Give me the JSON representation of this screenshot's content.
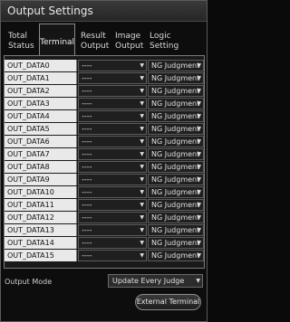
{
  "window": {
    "title": "Output Settings"
  },
  "tabs": [
    {
      "label_line1": "Total",
      "label_line2": "Status",
      "active": false
    },
    {
      "label_line1": "Terminal",
      "label_line2": "",
      "active": true
    },
    {
      "label_line1": "Result",
      "label_line2": "Output",
      "active": false
    },
    {
      "label_line1": "Image",
      "label_line2": "Output",
      "active": false
    },
    {
      "label_line1": "Logic",
      "label_line2": "Setting",
      "active": false
    }
  ],
  "rows": [
    {
      "name": "OUT_DATA0",
      "item": "----",
      "mode": "NG Judgment"
    },
    {
      "name": "OUT_DATA1",
      "item": "----",
      "mode": "NG Judgment"
    },
    {
      "name": "OUT_DATA2",
      "item": "----",
      "mode": "NG Judgment"
    },
    {
      "name": "OUT_DATA3",
      "item": "----",
      "mode": "NG Judgment"
    },
    {
      "name": "OUT_DATA4",
      "item": "----",
      "mode": "NG Judgment"
    },
    {
      "name": "OUT_DATA5",
      "item": "----",
      "mode": "NG Judgment"
    },
    {
      "name": "OUT_DATA6",
      "item": "----",
      "mode": "NG Judgment"
    },
    {
      "name": "OUT_DATA7",
      "item": "----",
      "mode": "NG Judgment"
    },
    {
      "name": "OUT_DATA8",
      "item": "----",
      "mode": "NG Judgment"
    },
    {
      "name": "OUT_DATA9",
      "item": "----",
      "mode": "NG Judgment"
    },
    {
      "name": "OUT_DATA10",
      "item": "----",
      "mode": "NG Judgment"
    },
    {
      "name": "OUT_DATA11",
      "item": "----",
      "mode": "NG Judgment"
    },
    {
      "name": "OUT_DATA12",
      "item": "----",
      "mode": "NG Judgment"
    },
    {
      "name": "OUT_DATA13",
      "item": "----",
      "mode": "NG Judgment"
    },
    {
      "name": "OUT_DATA14",
      "item": "----",
      "mode": "NG Judgment"
    },
    {
      "name": "OUT_DATA15",
      "item": "----",
      "mode": "NG Judgment"
    }
  ],
  "output_mode": {
    "label": "Output Mode",
    "value": "Update Every Judge"
  },
  "external_terminal": {
    "label": "External Terminal"
  },
  "icons": {
    "dropdown": "chevron-down-icon",
    "glyph": "▼"
  }
}
